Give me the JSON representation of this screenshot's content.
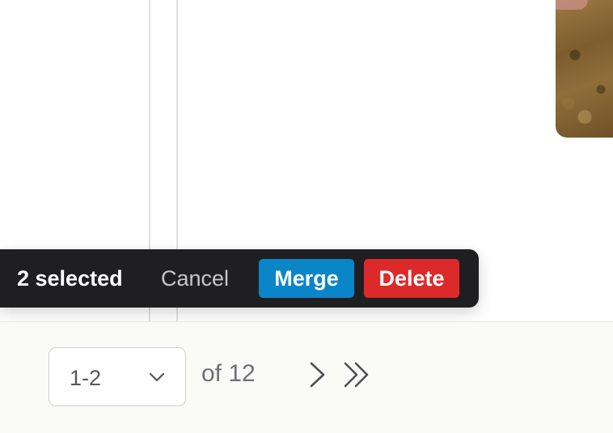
{
  "selection_bar": {
    "count_text": "2 selected",
    "cancel_label": "Cancel",
    "merge_label": "Merge",
    "delete_label": "Delete"
  },
  "pagination": {
    "range_value": "1-2",
    "total_text": "of 12"
  },
  "icons": {
    "range_dropdown": "chevron-down-icon",
    "next": "chevron-right-icon",
    "last": "double-chevron-right-icon"
  },
  "colors": {
    "selection_bar_bg": "#1f1f22",
    "merge_button": "#0a85c8",
    "delete_button": "#dc2a2a",
    "footer_bg": "#fafaf9"
  }
}
